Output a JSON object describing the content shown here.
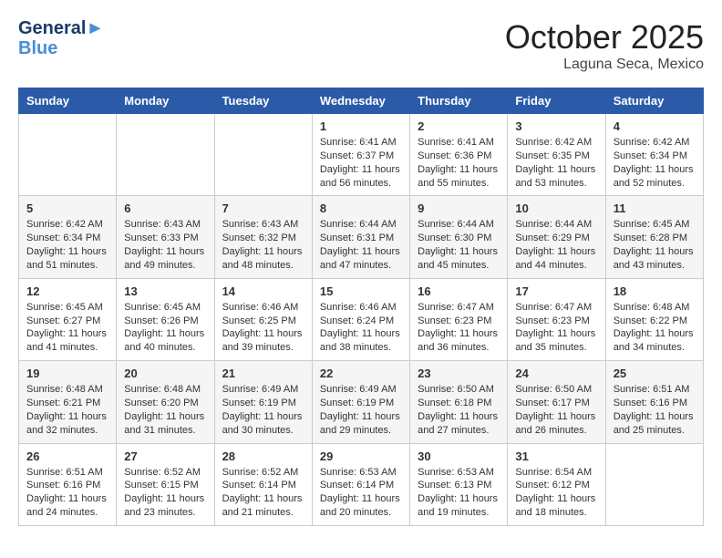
{
  "header": {
    "logo_line1": "General",
    "logo_line2": "Blue",
    "month": "October 2025",
    "location": "Laguna Seca, Mexico"
  },
  "days_of_week": [
    "Sunday",
    "Monday",
    "Tuesday",
    "Wednesday",
    "Thursday",
    "Friday",
    "Saturday"
  ],
  "weeks": [
    [
      {
        "day": "",
        "info": ""
      },
      {
        "day": "",
        "info": ""
      },
      {
        "day": "",
        "info": ""
      },
      {
        "day": "1",
        "info": "Sunrise: 6:41 AM\nSunset: 6:37 PM\nDaylight: 11 hours and 56 minutes."
      },
      {
        "day": "2",
        "info": "Sunrise: 6:41 AM\nSunset: 6:36 PM\nDaylight: 11 hours and 55 minutes."
      },
      {
        "day": "3",
        "info": "Sunrise: 6:42 AM\nSunset: 6:35 PM\nDaylight: 11 hours and 53 minutes."
      },
      {
        "day": "4",
        "info": "Sunrise: 6:42 AM\nSunset: 6:34 PM\nDaylight: 11 hours and 52 minutes."
      }
    ],
    [
      {
        "day": "5",
        "info": "Sunrise: 6:42 AM\nSunset: 6:34 PM\nDaylight: 11 hours and 51 minutes."
      },
      {
        "day": "6",
        "info": "Sunrise: 6:43 AM\nSunset: 6:33 PM\nDaylight: 11 hours and 49 minutes."
      },
      {
        "day": "7",
        "info": "Sunrise: 6:43 AM\nSunset: 6:32 PM\nDaylight: 11 hours and 48 minutes."
      },
      {
        "day": "8",
        "info": "Sunrise: 6:44 AM\nSunset: 6:31 PM\nDaylight: 11 hours and 47 minutes."
      },
      {
        "day": "9",
        "info": "Sunrise: 6:44 AM\nSunset: 6:30 PM\nDaylight: 11 hours and 45 minutes."
      },
      {
        "day": "10",
        "info": "Sunrise: 6:44 AM\nSunset: 6:29 PM\nDaylight: 11 hours and 44 minutes."
      },
      {
        "day": "11",
        "info": "Sunrise: 6:45 AM\nSunset: 6:28 PM\nDaylight: 11 hours and 43 minutes."
      }
    ],
    [
      {
        "day": "12",
        "info": "Sunrise: 6:45 AM\nSunset: 6:27 PM\nDaylight: 11 hours and 41 minutes."
      },
      {
        "day": "13",
        "info": "Sunrise: 6:45 AM\nSunset: 6:26 PM\nDaylight: 11 hours and 40 minutes."
      },
      {
        "day": "14",
        "info": "Sunrise: 6:46 AM\nSunset: 6:25 PM\nDaylight: 11 hours and 39 minutes."
      },
      {
        "day": "15",
        "info": "Sunrise: 6:46 AM\nSunset: 6:24 PM\nDaylight: 11 hours and 38 minutes."
      },
      {
        "day": "16",
        "info": "Sunrise: 6:47 AM\nSunset: 6:23 PM\nDaylight: 11 hours and 36 minutes."
      },
      {
        "day": "17",
        "info": "Sunrise: 6:47 AM\nSunset: 6:23 PM\nDaylight: 11 hours and 35 minutes."
      },
      {
        "day": "18",
        "info": "Sunrise: 6:48 AM\nSunset: 6:22 PM\nDaylight: 11 hours and 34 minutes."
      }
    ],
    [
      {
        "day": "19",
        "info": "Sunrise: 6:48 AM\nSunset: 6:21 PM\nDaylight: 11 hours and 32 minutes."
      },
      {
        "day": "20",
        "info": "Sunrise: 6:48 AM\nSunset: 6:20 PM\nDaylight: 11 hours and 31 minutes."
      },
      {
        "day": "21",
        "info": "Sunrise: 6:49 AM\nSunset: 6:19 PM\nDaylight: 11 hours and 30 minutes."
      },
      {
        "day": "22",
        "info": "Sunrise: 6:49 AM\nSunset: 6:19 PM\nDaylight: 11 hours and 29 minutes."
      },
      {
        "day": "23",
        "info": "Sunrise: 6:50 AM\nSunset: 6:18 PM\nDaylight: 11 hours and 27 minutes."
      },
      {
        "day": "24",
        "info": "Sunrise: 6:50 AM\nSunset: 6:17 PM\nDaylight: 11 hours and 26 minutes."
      },
      {
        "day": "25",
        "info": "Sunrise: 6:51 AM\nSunset: 6:16 PM\nDaylight: 11 hours and 25 minutes."
      }
    ],
    [
      {
        "day": "26",
        "info": "Sunrise: 6:51 AM\nSunset: 6:16 PM\nDaylight: 11 hours and 24 minutes."
      },
      {
        "day": "27",
        "info": "Sunrise: 6:52 AM\nSunset: 6:15 PM\nDaylight: 11 hours and 23 minutes."
      },
      {
        "day": "28",
        "info": "Sunrise: 6:52 AM\nSunset: 6:14 PM\nDaylight: 11 hours and 21 minutes."
      },
      {
        "day": "29",
        "info": "Sunrise: 6:53 AM\nSunset: 6:14 PM\nDaylight: 11 hours and 20 minutes."
      },
      {
        "day": "30",
        "info": "Sunrise: 6:53 AM\nSunset: 6:13 PM\nDaylight: 11 hours and 19 minutes."
      },
      {
        "day": "31",
        "info": "Sunrise: 6:54 AM\nSunset: 6:12 PM\nDaylight: 11 hours and 18 minutes."
      },
      {
        "day": "",
        "info": ""
      }
    ]
  ]
}
